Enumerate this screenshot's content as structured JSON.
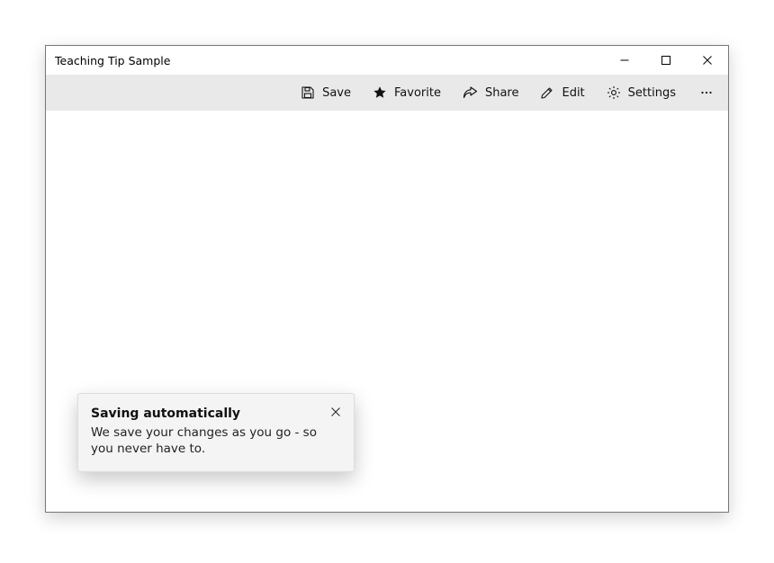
{
  "window": {
    "title": "Teaching Tip Sample"
  },
  "commandbar": {
    "save": "Save",
    "favorite": "Favorite",
    "share": "Share",
    "edit": "Edit",
    "settings": "Settings"
  },
  "teaching_tip": {
    "title": "Saving automatically",
    "body": "We save your changes as you go - so you never have to."
  }
}
